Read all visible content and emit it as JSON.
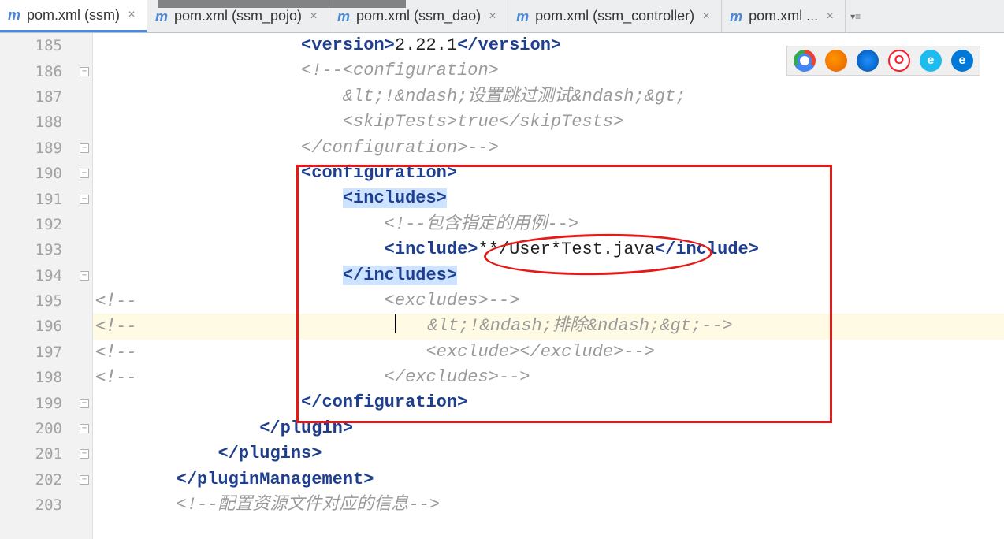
{
  "tabs": [
    {
      "icon": "m",
      "label": "pom.xml (ssm)",
      "close": "×",
      "active": true
    },
    {
      "icon": "m",
      "label": "pom.xml (ssm_pojo)",
      "close": "×",
      "active": false
    },
    {
      "icon": "m",
      "label": "pom.xml (ssm_dao)",
      "close": "×",
      "active": false
    },
    {
      "icon": "m",
      "label": "pom.xml (ssm_controller)",
      "close": "×",
      "active": false
    },
    {
      "icon": "m",
      "label": "pom.xml ...",
      "close": "×",
      "active": false
    }
  ],
  "moreTabs": "▾≡",
  "gutter": {
    "start": 185,
    "end": 203
  },
  "marginComments": {
    "l195": "<!--",
    "l196": "<!--",
    "l197": "<!--",
    "l198": "<!--"
  },
  "code": {
    "l185": {
      "pad": "                    ",
      "t1": "<version>",
      "txt": "2.22.1",
      "t2": "</version>"
    },
    "l186": {
      "pad": "                    ",
      "cmt": "<!--<configuration>"
    },
    "l187": {
      "pad": "                        ",
      "cmt": "&lt;!&ndash;设置跳过测试&ndash;&gt;"
    },
    "l188": {
      "pad": "                        ",
      "cmt": "<skipTests>true</skipTests>"
    },
    "l189": {
      "pad": "                    ",
      "cmt": "</configuration>-->"
    },
    "l190": {
      "pad": "                    ",
      "t1": "<configuration>"
    },
    "l191": {
      "pad": "                        ",
      "t1": "<includes>"
    },
    "l192": {
      "pad": "                            ",
      "cmt": "<!--包含指定的用例-->"
    },
    "l193": {
      "pad": "                            ",
      "t1": "<include>",
      "txt": "**/User*Test.java",
      "t2": "</include>"
    },
    "l194": {
      "pad": "                        ",
      "t1": "</includes>"
    },
    "l195": {
      "pad": "                            ",
      "cmt": "<excludes>-->"
    },
    "l196": {
      "pad": "                             ",
      "cmt": "   &lt;!&ndash;排除&ndash;&gt;-->"
    },
    "l197": {
      "pad": "                                ",
      "cmt": "<exclude></exclude>-->"
    },
    "l198": {
      "pad": "                            ",
      "cmt": "</excludes>-->"
    },
    "l199": {
      "pad": "                    ",
      "t1": "</configuration>"
    },
    "l200": {
      "pad": "                ",
      "t1": "</plugin>"
    },
    "l201": {
      "pad": "            ",
      "t1": "</plugins>"
    },
    "l202": {
      "pad": "        ",
      "t1": "</pluginManagement>"
    },
    "l203": {
      "pad": "        ",
      "cmt": "<!--配置资源文件对应的信息-->"
    }
  },
  "browsers": {
    "chrome": "",
    "firefox": "",
    "safari": "",
    "opera": "O",
    "ie": "e",
    "edge": "e"
  }
}
